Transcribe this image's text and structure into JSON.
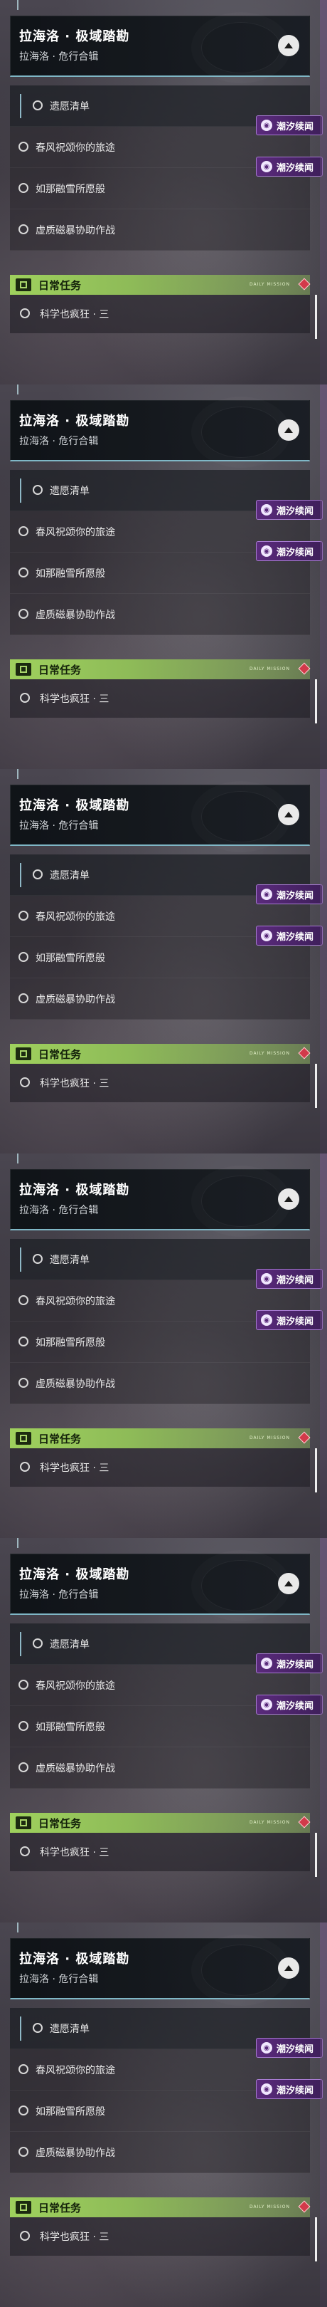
{
  "panels": [
    {
      "quest_title": "拉海洛 · 极域踏勘",
      "quest_subtitle": "拉海洛 · 危行合辑",
      "quests": [
        {
          "label": "遗愿清单",
          "active": true,
          "tag": ""
        },
        {
          "label": "春风祝颂你的旅途",
          "active": false,
          "tag": "潮汐续闻"
        },
        {
          "label": "如那融雪所愿般",
          "active": false,
          "tag": "潮汐续闻"
        },
        {
          "label": "虚质磁暴协助作战",
          "active": false,
          "tag": ""
        }
      ],
      "daily_label": "日常任务",
      "daily_sub": "DAILY MISSION",
      "daily_task": "科学也疯狂 · 三"
    },
    {
      "quest_title": "拉海洛 · 极域踏勘",
      "quest_subtitle": "拉海洛 · 危行合辑",
      "quests": [
        {
          "label": "遗愿清单",
          "active": true,
          "tag": ""
        },
        {
          "label": "春风祝颂你的旅途",
          "active": false,
          "tag": "潮汐续闻"
        },
        {
          "label": "如那融雪所愿般",
          "active": false,
          "tag": "潮汐续闻"
        },
        {
          "label": "虚质磁暴协助作战",
          "active": false,
          "tag": ""
        }
      ],
      "daily_label": "日常任务",
      "daily_sub": "DAILY MISSION",
      "daily_task": "科学也疯狂 · 三"
    },
    {
      "quest_title": "拉海洛 · 极域踏勘",
      "quest_subtitle": "拉海洛 · 危行合辑",
      "quests": [
        {
          "label": "遗愿清单",
          "active": true,
          "tag": ""
        },
        {
          "label": "春风祝颂你的旅途",
          "active": false,
          "tag": "潮汐续闻"
        },
        {
          "label": "如那融雪所愿般",
          "active": false,
          "tag": "潮汐续闻"
        },
        {
          "label": "虚质磁暴协助作战",
          "active": false,
          "tag": ""
        }
      ],
      "daily_label": "日常任务",
      "daily_sub": "DAILY MISSION",
      "daily_task": "科学也疯狂 · 三"
    },
    {
      "quest_title": "拉海洛 · 极域踏勘",
      "quest_subtitle": "拉海洛 · 危行合辑",
      "quests": [
        {
          "label": "遗愿清单",
          "active": true,
          "tag": ""
        },
        {
          "label": "春风祝颂你的旅途",
          "active": false,
          "tag": "潮汐续闻"
        },
        {
          "label": "如那融雪所愿般",
          "active": false,
          "tag": "潮汐续闻"
        },
        {
          "label": "虚质磁暴协助作战",
          "active": false,
          "tag": ""
        }
      ],
      "daily_label": "日常任务",
      "daily_sub": "DAILY MISSION",
      "daily_task": "科学也疯狂 · 三"
    },
    {
      "quest_title": "拉海洛 · 极域踏勘",
      "quest_subtitle": "拉海洛 · 危行合辑",
      "quests": [
        {
          "label": "遗愿清单",
          "active": true,
          "tag": ""
        },
        {
          "label": "春风祝颂你的旅途",
          "active": false,
          "tag": "潮汐续闻"
        },
        {
          "label": "如那融雪所愿般",
          "active": false,
          "tag": "潮汐续闻"
        },
        {
          "label": "虚质磁暴协助作战",
          "active": false,
          "tag": ""
        }
      ],
      "daily_label": "日常任务",
      "daily_sub": "DAILY MISSION",
      "daily_task": "科学也疯狂 · 三"
    },
    {
      "quest_title": "拉海洛 · 极域踏勘",
      "quest_subtitle": "拉海洛 · 危行合辑",
      "quests": [
        {
          "label": "遗愿清单",
          "active": true,
          "tag": ""
        },
        {
          "label": "春风祝颂你的旅途",
          "active": false,
          "tag": "潮汐续闻"
        },
        {
          "label": "如那融雪所愿般",
          "active": false,
          "tag": "潮汐续闻"
        },
        {
          "label": "虚质磁暴协助作战",
          "active": false,
          "tag": ""
        }
      ],
      "daily_label": "日常任务",
      "daily_sub": "DAILY MISSION",
      "daily_task": "科学也疯狂 · 三"
    }
  ],
  "icons": {
    "collapse": "chevron-up-icon",
    "quest_status": "circle-outline-icon",
    "tag": "tide-icon",
    "daily": "book-icon",
    "alert": "red-diamond-icon"
  },
  "colors": {
    "accent_cyan": "#7fb7c6",
    "daily_green": "#9fd15d",
    "tag_purple": "#5a2a7c",
    "alert_red": "#d23a4a"
  }
}
